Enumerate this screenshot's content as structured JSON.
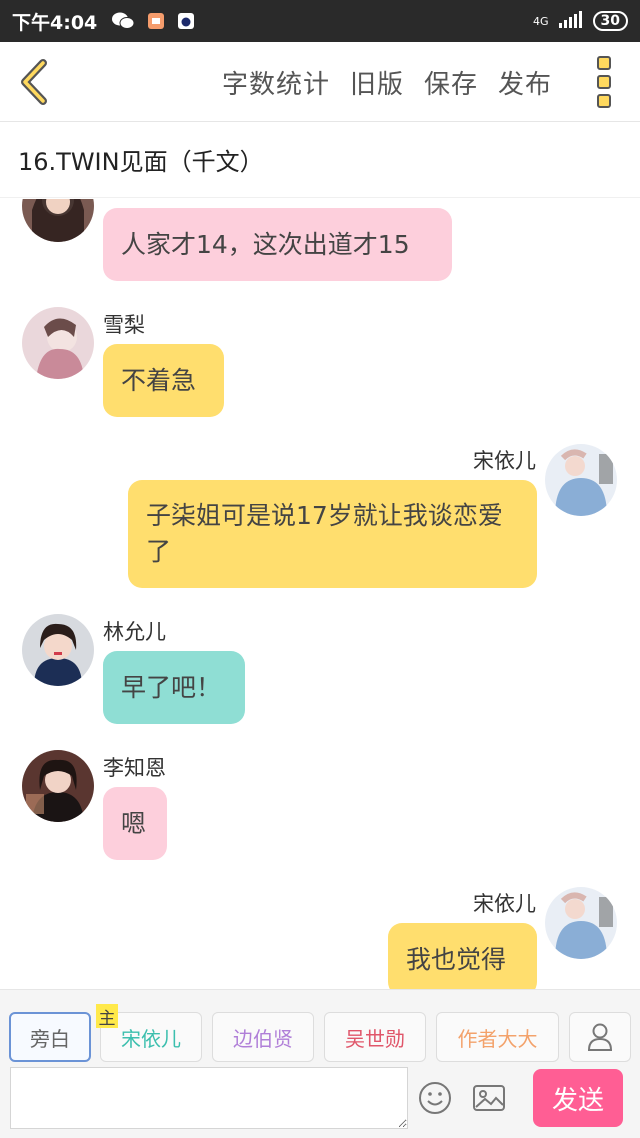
{
  "status_bar": {
    "time": "下午4:04",
    "signal": "4G",
    "battery": "30"
  },
  "toolbar": {
    "actions": [
      "字数统计",
      "旧版",
      "保存",
      "发布"
    ],
    "back_icon": "chevron-left-icon",
    "more_icon": "more-vertical-icon",
    "accent_color": "#ffd95e"
  },
  "chapter": {
    "title": "16.TWIN见面（千文）"
  },
  "messages": [
    {
      "side": "left",
      "name": "",
      "text": "人家才14，这次出道才15",
      "color": "pink"
    },
    {
      "side": "left",
      "name": "雪梨",
      "text": "不着急",
      "color": "yellow"
    },
    {
      "side": "right",
      "name": "宋依儿",
      "text": "子柒姐可是说17岁就让我谈恋爱了",
      "color": "yellow"
    },
    {
      "side": "left",
      "name": "林允儿",
      "text": "早了吧！",
      "color": "teal"
    },
    {
      "side": "left",
      "name": "李知恩",
      "text": "嗯",
      "color": "pink"
    },
    {
      "side": "right",
      "name": "宋依儿",
      "text": "我也觉得",
      "color": "yellow"
    }
  ],
  "roles": {
    "narrator": "旁白",
    "main_tag": "主",
    "items": [
      {
        "label": "宋依儿",
        "color": "#3cbfae"
      },
      {
        "label": "边伯贤",
        "color": "#b07fd8"
      },
      {
        "label": "吴世勋",
        "color": "#e0566a"
      },
      {
        "label": "作者大大",
        "color": "#f3a26b"
      }
    ],
    "add_role_icon": "user-icon"
  },
  "input": {
    "placeholder": "",
    "value": "",
    "send_label": "发送",
    "send_color": "#ff5e94"
  }
}
